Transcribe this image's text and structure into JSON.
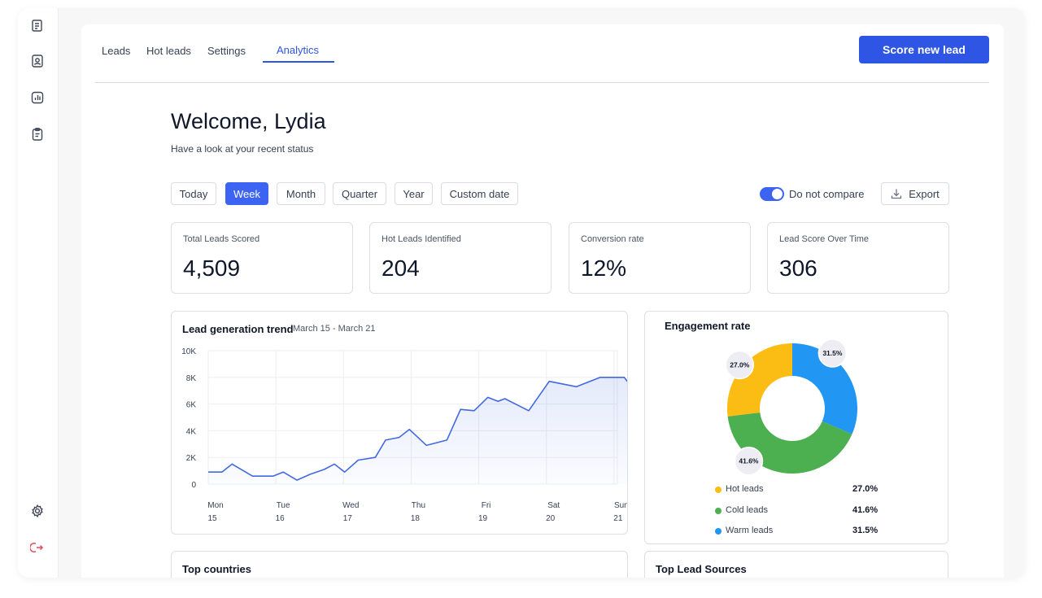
{
  "nav": {
    "tabs": [
      {
        "label": "Leads"
      },
      {
        "label": "Hot leads"
      },
      {
        "label": "Settings"
      },
      {
        "label": "Analytics"
      }
    ],
    "active_tab": "Analytics",
    "primary_button": "Score new lead"
  },
  "sidebar": {
    "icons": [
      "document-icon",
      "contact-card-icon",
      "analytics-icon",
      "clipboard-icon",
      "gear-icon",
      "logout-icon"
    ]
  },
  "welcome": {
    "title": "Welcome, Lydia",
    "subtitle": "Have a look at your recent status"
  },
  "filters": {
    "options": [
      "Today",
      "Week",
      "Month",
      "Quarter",
      "Year",
      "Custom date"
    ],
    "selected": "Week",
    "compare_label": "Do not compare",
    "compare_enabled": true,
    "export_label": "Export"
  },
  "kpis": [
    {
      "label": "Total Leads Scored",
      "value": "4,509"
    },
    {
      "label": "Hot Leads Identified",
      "value": "204"
    },
    {
      "label": "Conversion rate",
      "value": "12%"
    },
    {
      "label": "Lead Score Over Time",
      "value": "306"
    }
  ],
  "trend": {
    "title": "Lead generation trend",
    "date_range": "March 15 - March 21"
  },
  "engagement": {
    "title": "Engagement rate",
    "legend": [
      {
        "name": "Hot leads",
        "pct": "27.0%"
      },
      {
        "name": "Cold leads",
        "pct": "41.6%"
      },
      {
        "name": "Warm leads",
        "pct": "31.5%"
      }
    ]
  },
  "bottom": {
    "countries_title": "Top countries",
    "sources_title": "Top Lead Sources"
  },
  "colors": {
    "accent": "#2f55e4",
    "line": "#4169e1",
    "hot": "#fbbc13",
    "cold": "#4caf50",
    "warm": "#2196f3"
  },
  "chart_data": [
    {
      "type": "area",
      "title": "Lead generation trend",
      "xlabel": "",
      "ylabel": "",
      "ylim": [
        0,
        10000
      ],
      "yticks": [
        0,
        2000,
        4000,
        6000,
        8000,
        10000
      ],
      "ytick_labels": [
        "0",
        "2K",
        "4K",
        "6K",
        "8K",
        "10K"
      ],
      "categories": [
        "Mon 15",
        "Tue 16",
        "Wed 17",
        "Thu 18",
        "Fri 19",
        "Sat 20",
        "Sun 21"
      ],
      "x_labels": [
        {
          "day": "Mon",
          "date": "15"
        },
        {
          "day": "Tue",
          "date": "16"
        },
        {
          "day": "Wed",
          "date": "17"
        },
        {
          "day": "Thu",
          "date": "18"
        },
        {
          "day": "Fri",
          "date": "19"
        },
        {
          "day": "Sat",
          "date": "20"
        },
        {
          "day": "Sun",
          "date": "21"
        }
      ],
      "grid": true,
      "points": [
        {
          "x": 0.0,
          "y": 900
        },
        {
          "x": 0.2,
          "y": 900
        },
        {
          "x": 0.35,
          "y": 1500
        },
        {
          "x": 0.65,
          "y": 600
        },
        {
          "x": 0.95,
          "y": 600
        },
        {
          "x": 1.1,
          "y": 900
        },
        {
          "x": 1.3,
          "y": 300
        },
        {
          "x": 1.5,
          "y": 750
        },
        {
          "x": 1.7,
          "y": 1100
        },
        {
          "x": 1.85,
          "y": 1500
        },
        {
          "x": 2.0,
          "y": 900
        },
        {
          "x": 2.2,
          "y": 1800
        },
        {
          "x": 2.45,
          "y": 2000
        },
        {
          "x": 2.6,
          "y": 3300
        },
        {
          "x": 2.8,
          "y": 3500
        },
        {
          "x": 2.95,
          "y": 4100
        },
        {
          "x": 3.2,
          "y": 2900
        },
        {
          "x": 3.5,
          "y": 3300
        },
        {
          "x": 3.7,
          "y": 5600
        },
        {
          "x": 3.9,
          "y": 5500
        },
        {
          "x": 4.1,
          "y": 6500
        },
        {
          "x": 4.25,
          "y": 6200
        },
        {
          "x": 4.35,
          "y": 6400
        },
        {
          "x": 4.7,
          "y": 5500
        },
        {
          "x": 5.0,
          "y": 7700
        },
        {
          "x": 5.4,
          "y": 7300
        },
        {
          "x": 5.75,
          "y": 8000
        },
        {
          "x": 6.1,
          "y": 8000
        },
        {
          "x": 6.3,
          "y": 6700
        },
        {
          "x": 6.6,
          "y": 7600
        }
      ]
    },
    {
      "type": "pie",
      "title": "Engagement rate",
      "donut": true,
      "slices": [
        {
          "label": "Hot leads",
          "value": 27.0,
          "color": "#fbbc13"
        },
        {
          "label": "Cold leads",
          "value": 41.6,
          "color": "#4caf50"
        },
        {
          "label": "Warm leads",
          "value": 31.5,
          "color": "#2196f3"
        }
      ],
      "data_labels": [
        "27.0%",
        "41.6%",
        "31.5%"
      ],
      "legend": "below"
    }
  ]
}
